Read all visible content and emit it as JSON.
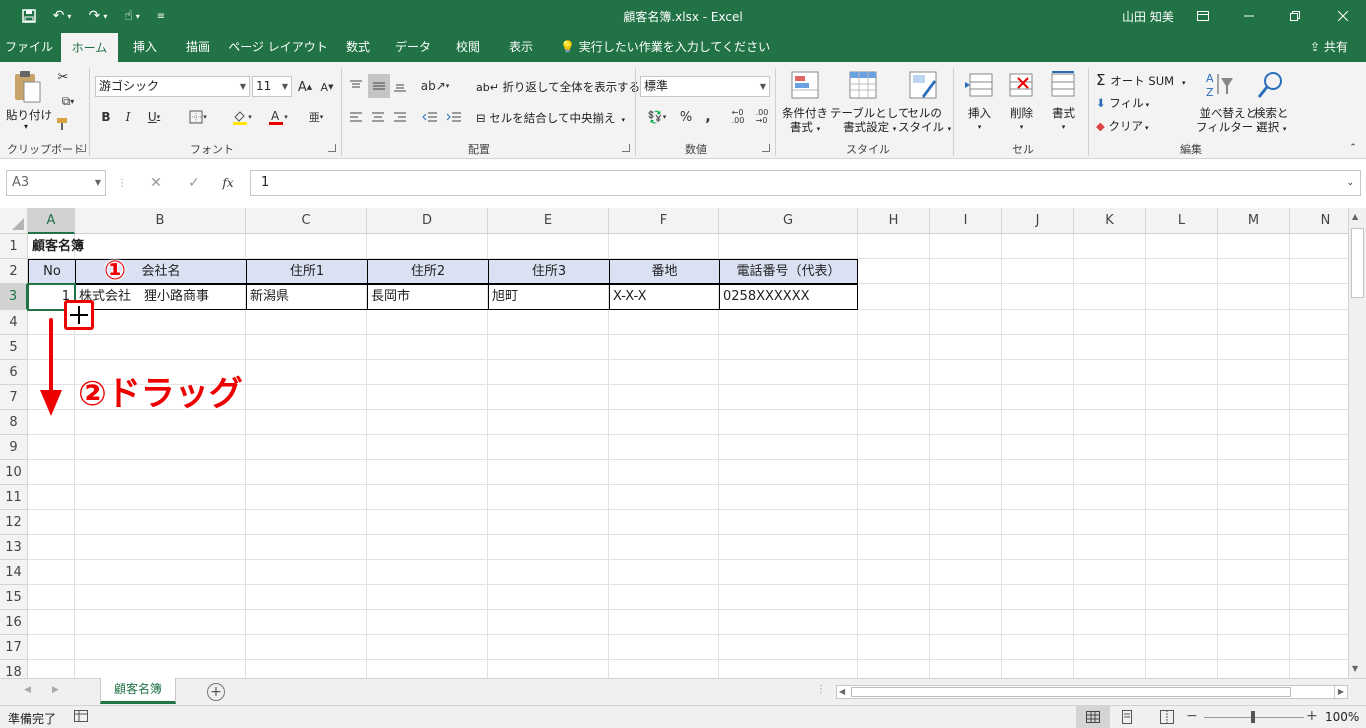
{
  "title_bar": {
    "doc_title": "顧客名簿.xlsx  -  Excel",
    "user": "山田 知美"
  },
  "tabs": [
    "ファイル",
    "ホーム",
    "挿入",
    "描画",
    "ページ レイアウト",
    "数式",
    "データ",
    "校閲",
    "表示"
  ],
  "tell_me": "実行したい作業を入力してください",
  "share": "共有",
  "ribbon": {
    "clipboard": {
      "paste": "貼り付け",
      "label": "クリップボード"
    },
    "font": {
      "name": "游ゴシック",
      "size": "11",
      "label": "フォント"
    },
    "alignment": {
      "wrap": "折り返して全体を表示する",
      "merge": "セルを結合して中央揃え",
      "label": "配置"
    },
    "number": {
      "format": "標準",
      "label": "数値"
    },
    "styles": {
      "conditional": [
        "条件付き",
        "書式"
      ],
      "table": [
        "テーブルとして",
        "書式設定"
      ],
      "cell": [
        "セルの",
        "スタイル"
      ],
      "label": "スタイル"
    },
    "cells": {
      "insert": "挿入",
      "delete": "削除",
      "format": "書式",
      "label": "セル"
    },
    "editing": {
      "autosum": "オート SUM",
      "fill": "フィル",
      "clear": "クリア",
      "sort": [
        "並べ替えと",
        "フィルター"
      ],
      "find": [
        "検索と",
        "選択"
      ],
      "label": "編集"
    }
  },
  "formula_bar": {
    "name_box": "A3",
    "fx": "fx",
    "value": "1"
  },
  "columns": [
    "A",
    "B",
    "C",
    "D",
    "E",
    "F",
    "G",
    "H",
    "I",
    "J",
    "K",
    "L",
    "M",
    "N"
  ],
  "rows": [
    "1",
    "2",
    "3",
    "4",
    "5",
    "6",
    "7",
    "8",
    "9",
    "10",
    "11",
    "12",
    "13",
    "14",
    "15",
    "16",
    "17",
    "18"
  ],
  "sheet": {
    "title": "顧客名簿",
    "headers": [
      "No",
      "会社名",
      "住所1",
      "住所2",
      "住所3",
      "番地",
      "電話番号（代表）"
    ],
    "row3": [
      "1",
      "株式会社　狸小路商事",
      "新潟県",
      "長岡市",
      "旭町",
      "X-X-X",
      "0258XXXXXX"
    ]
  },
  "annotations": {
    "step1": "①",
    "step2": "②ドラッグ"
  },
  "sheet_tab": "顧客名簿",
  "status": {
    "ready": "準備完了",
    "zoom": "100%"
  },
  "colors": {
    "excel_green": "#217346",
    "header_fill": "#dae1f3",
    "annotation_red": "#e00000"
  }
}
